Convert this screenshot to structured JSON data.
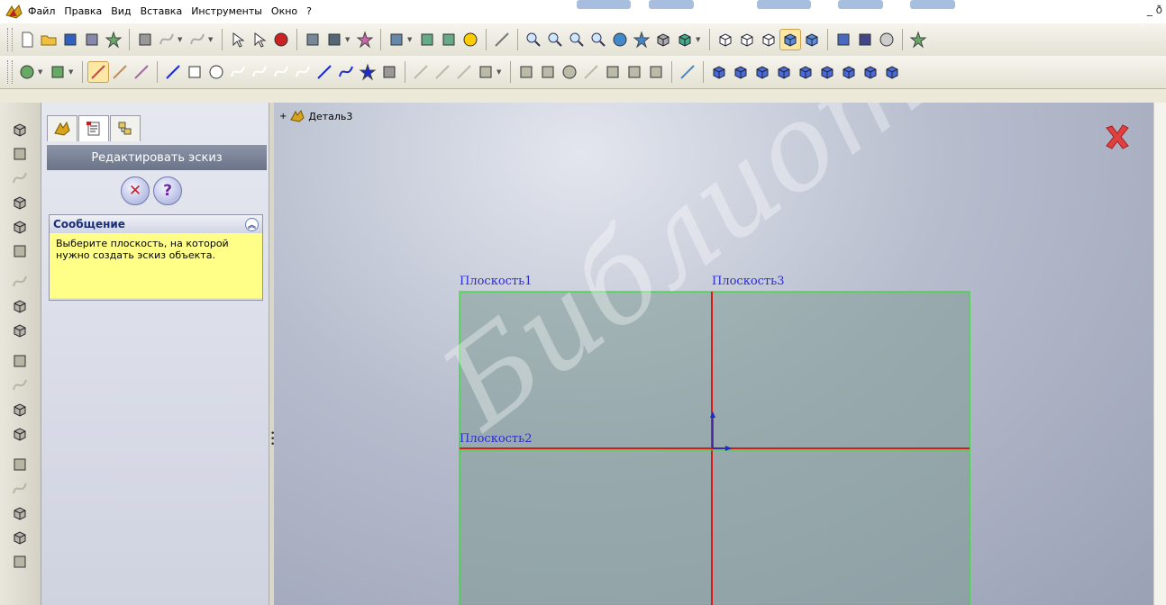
{
  "menu": {
    "items": [
      "Файл",
      "Правка",
      "Вид",
      "Вставка",
      "Инструменты",
      "Окно",
      "?"
    ]
  },
  "window_controls": "_ ð",
  "feature_manager": {
    "tabs": [
      "feature-tree",
      "property-manager",
      "configuration-manager"
    ],
    "pm_title": "Редактировать эскиз",
    "ok_symbol": "✕",
    "help_symbol": "?",
    "message": {
      "header": "Сообщение",
      "text": "Выберите плоскость, на которой нужно создать эскиз объекта."
    }
  },
  "viewport": {
    "tree_root": "Деталь3",
    "plane_labels": {
      "front": "Плоскость1",
      "right": "Плоскость3",
      "top": "Плоскость2"
    }
  },
  "watermark": {
    "main": "Библиотека БГУ"
  },
  "colors": {
    "plane_edge": "#33e033",
    "plane_fill": "#7f9a94",
    "axis_red": "#d61a1a",
    "label_blue": "#2a2ad8",
    "message_bg": "#ffff88"
  }
}
